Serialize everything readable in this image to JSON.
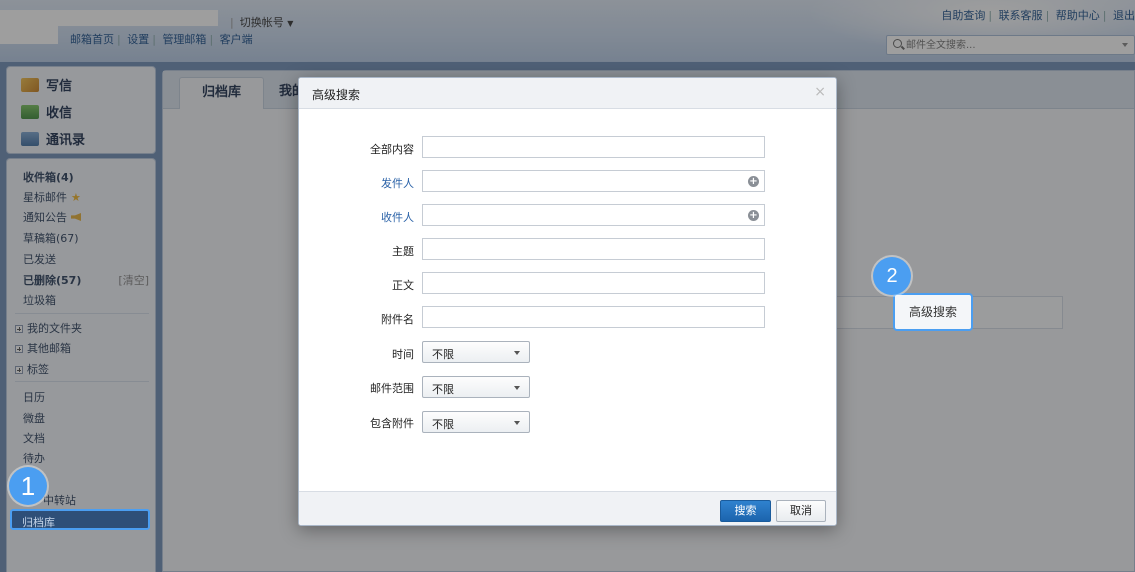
{
  "header": {
    "switch_account": "切换帐号",
    "links": [
      "邮箱首页",
      "设置",
      "管理邮箱",
      "客户端"
    ],
    "top_links": [
      "自助查询",
      "联系客服",
      "帮助中心",
      "退出"
    ],
    "search_placeholder": "邮件全文搜索..."
  },
  "sidebar": {
    "write": "写信",
    "receive": "收信",
    "contacts": "通讯录",
    "inbox": "收件箱(4)",
    "starred": "星标邮件",
    "notice": "通知公告",
    "drafts": "草稿箱(67)",
    "sent": "已发送",
    "deleted": "已删除(57)",
    "clear": "[清空]",
    "trash": "垃圾箱",
    "my_folders": "我的文件夹",
    "other_mailboxes": "其他邮箱",
    "tags": "标签",
    "calendar": "日历",
    "netdisk": "微盘",
    "docs": "文档",
    "todo": "待办",
    "transfer_partial": "中转站",
    "archive": "归档库"
  },
  "main": {
    "tab_archive": "归档库",
    "tab_second_partial": "我的",
    "advanced_search_button": "高级搜索"
  },
  "modal": {
    "title": "高级搜索",
    "close": "×",
    "fields": {
      "all_content": "全部内容",
      "sender": "发件人",
      "recipient": "收件人",
      "subject": "主题",
      "body": "正文",
      "attachment_name": "附件名",
      "time": "时间",
      "scope": "邮件范围",
      "has_attachment": "包含附件"
    },
    "selects": {
      "time": "不限",
      "scope": "不限",
      "has_attachment": "不限"
    },
    "search_button": "搜索",
    "cancel_button": "取消"
  },
  "badges": {
    "one": "1",
    "two": "2"
  },
  "colors": {
    "highlight": "#4b9ef1",
    "primary_button": "#1c64ad",
    "link": "#2c63a8"
  }
}
